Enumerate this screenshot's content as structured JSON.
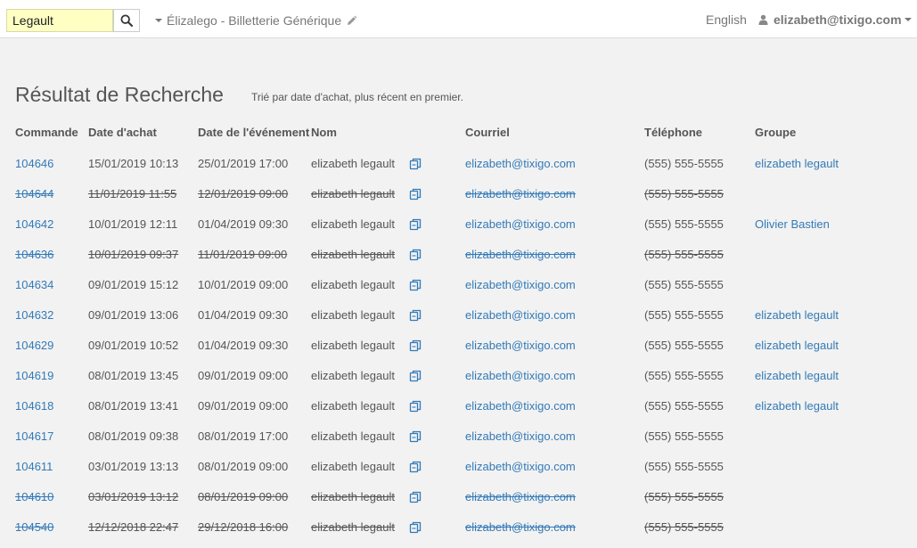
{
  "header": {
    "search_value": "Legault",
    "event_name": "Élizalego - Billetterie Générique",
    "language": "English",
    "user_email": "elizabeth@tixigo.com"
  },
  "page": {
    "title": "Résultat de Recherche",
    "subtitle": "Trié par date d'achat, plus récent en premier."
  },
  "table": {
    "columns": [
      "Commande",
      "Date d'achat",
      "Date de l'événement",
      "Nom",
      "Courriel",
      "Téléphone",
      "Groupe"
    ],
    "rows": [
      {
        "order": "104646",
        "purchase": "15/01/2019 10:13",
        "event": "25/01/2019 17:00",
        "name": "elizabeth legault",
        "email": "elizabeth@tixigo.com",
        "phone": "(555) 555-5555",
        "group": "elizabeth legault",
        "cancelled": false
      },
      {
        "order": "104644",
        "purchase": "11/01/2019 11:55",
        "event": "12/01/2019 09:00",
        "name": "elizabeth legault",
        "email": "elizabeth@tixigo.com",
        "phone": "(555) 555-5555",
        "group": "",
        "cancelled": true
      },
      {
        "order": "104642",
        "purchase": "10/01/2019 12:11",
        "event": "01/04/2019 09:30",
        "name": "elizabeth legault",
        "email": "elizabeth@tixigo.com",
        "phone": "(555) 555-5555",
        "group": "Olivier Bastien",
        "cancelled": false
      },
      {
        "order": "104636",
        "purchase": "10/01/2019 09:37",
        "event": "11/01/2019 09:00",
        "name": "elizabeth legault",
        "email": "elizabeth@tixigo.com",
        "phone": "(555) 555-5555",
        "group": "",
        "cancelled": true
      },
      {
        "order": "104634",
        "purchase": "09/01/2019 15:12",
        "event": "10/01/2019 09:00",
        "name": "elizabeth legault",
        "email": "elizabeth@tixigo.com",
        "phone": "(555) 555-5555",
        "group": "",
        "cancelled": false
      },
      {
        "order": "104632",
        "purchase": "09/01/2019 13:06",
        "event": "01/04/2019 09:30",
        "name": "elizabeth legault",
        "email": "elizabeth@tixigo.com",
        "phone": "(555) 555-5555",
        "group": "elizabeth legault",
        "cancelled": false
      },
      {
        "order": "104629",
        "purchase": "09/01/2019 10:52",
        "event": "01/04/2019 09:30",
        "name": "elizabeth legault",
        "email": "elizabeth@tixigo.com",
        "phone": "(555) 555-5555",
        "group": "elizabeth legault",
        "cancelled": false
      },
      {
        "order": "104619",
        "purchase": "08/01/2019 13:45",
        "event": "09/01/2019 09:00",
        "name": "elizabeth legault",
        "email": "elizabeth@tixigo.com",
        "phone": "(555) 555-5555",
        "group": "elizabeth legault",
        "cancelled": false
      },
      {
        "order": "104618",
        "purchase": "08/01/2019 13:41",
        "event": "09/01/2019 09:00",
        "name": "elizabeth legault",
        "email": "elizabeth@tixigo.com",
        "phone": "(555) 555-5555",
        "group": "elizabeth legault",
        "cancelled": false
      },
      {
        "order": "104617",
        "purchase": "08/01/2019 09:38",
        "event": "08/01/2019 17:00",
        "name": "elizabeth legault",
        "email": "elizabeth@tixigo.com",
        "phone": "(555) 555-5555",
        "group": "",
        "cancelled": false
      },
      {
        "order": "104611",
        "purchase": "03/01/2019 13:13",
        "event": "08/01/2019 09:00",
        "name": "elizabeth legault",
        "email": "elizabeth@tixigo.com",
        "phone": "(555) 555-5555",
        "group": "",
        "cancelled": false
      },
      {
        "order": "104610",
        "purchase": "03/01/2019 13:12",
        "event": "08/01/2019 09:00",
        "name": "elizabeth legault",
        "email": "elizabeth@tixigo.com",
        "phone": "(555) 555-5555",
        "group": "",
        "cancelled": true
      },
      {
        "order": "104540",
        "purchase": "12/12/2018 22:47",
        "event": "29/12/2018 16:00",
        "name": "elizabeth legault",
        "email": "elizabeth@tixigo.com",
        "phone": "(555) 555-5555",
        "group": "",
        "cancelled": true
      }
    ]
  },
  "icons": {
    "search": "search-icon",
    "edit": "pencil-icon",
    "user": "user-icon",
    "copy": "copy-icon",
    "dropdown": "caret-down-icon"
  },
  "colors": {
    "link": "#337ab7",
    "search_highlight": "#ffffc4",
    "background": "#f2f2f2"
  }
}
